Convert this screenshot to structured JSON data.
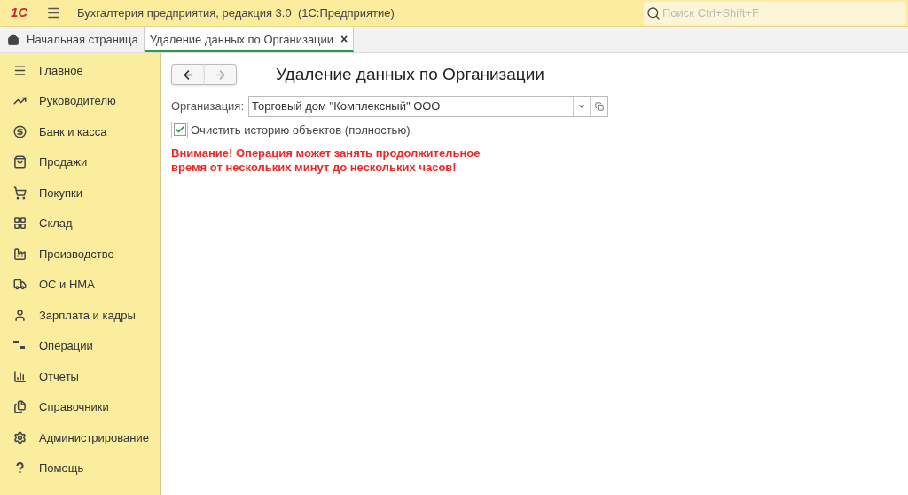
{
  "app_bar": {
    "logo": "1С",
    "title": "Бухгалтерия предприятия, редакция 3.0  (1С:Предприятие)",
    "search": {
      "placeholder": "Поиск Ctrl+Shift+F"
    }
  },
  "tabs": [
    {
      "label": "Начальная страница",
      "selected": false
    },
    {
      "label": "Удаление данных по Организации",
      "selected": true,
      "close": "×"
    }
  ],
  "sidebar": {
    "items": [
      {
        "label": "Главное"
      },
      {
        "label": "Руководителю"
      },
      {
        "label": "Банк и касса"
      },
      {
        "label": "Продажи"
      },
      {
        "label": "Покупки"
      },
      {
        "label": "Склад"
      },
      {
        "label": "Производство"
      },
      {
        "label": "ОС и НМА"
      },
      {
        "label": "Зарплата и кадры"
      },
      {
        "label": "Операции"
      },
      {
        "label": "Отчеты"
      },
      {
        "label": "Справочники"
      },
      {
        "label": "Администрирование"
      },
      {
        "label": "Помощь"
      }
    ]
  },
  "form": {
    "nav": [
      {
        "kind": "back",
        "disabled": false
      },
      {
        "kind": "forward",
        "disabled": true
      }
    ],
    "title": "Удаление данных по Организации",
    "organization": {
      "label": "Организация:",
      "value": "Торговый дом \"Комплексный\" ООО"
    },
    "clear_history": {
      "label": "Очистить историю объектов (полностью)",
      "checked": true
    },
    "warning": "Внимание! Операция может занять продолжительное\nвремя от нескольких минут до нескольких часов!"
  }
}
